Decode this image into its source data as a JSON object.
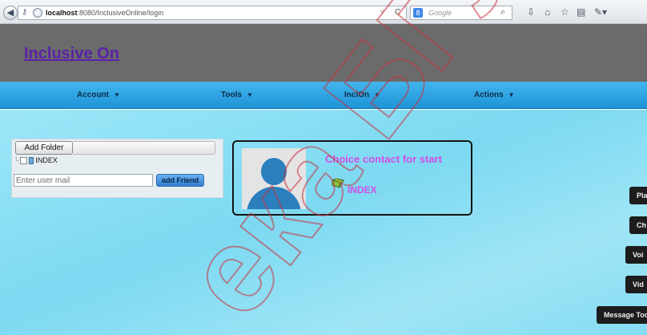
{
  "browser": {
    "url_host": "localhost",
    "url_rest": ":8080/InclusiveOnline/login",
    "search_placeholder": "Google",
    "search_engine_badge": "8",
    "icons": [
      "back-icon",
      "key-icon",
      "globe-icon",
      "star-icon",
      "reload-icon",
      "search-icon",
      "download-icon",
      "home-icon",
      "bookmark-star-icon",
      "clipboard-icon",
      "extension-icon"
    ]
  },
  "site": {
    "title": "Inclusive On"
  },
  "menu": {
    "items": [
      {
        "label": "Account",
        "caret": "▼"
      },
      {
        "label": "Tools",
        "caret": "▼"
      },
      {
        "label": "InclOn",
        "caret": "▼"
      },
      {
        "label": "Actions",
        "caret": "▼"
      }
    ]
  },
  "left_panel": {
    "add_folder_label": "Add Folder",
    "tree_item_label": "INDEX",
    "mail_placeholder": "Enter user mail",
    "add_friend_label": "add Friend"
  },
  "contact": {
    "choice_text": "Choice contact for start",
    "index_label": "INDEX"
  },
  "side_buttons": [
    {
      "label": "Pla"
    },
    {
      "label": "Ch"
    },
    {
      "label": "Voi"
    },
    {
      "label": "Vid"
    },
    {
      "label": "Message Too"
    }
  ],
  "watermark": {
    "text": "ека БГУИ",
    "color": "#c8323c"
  }
}
